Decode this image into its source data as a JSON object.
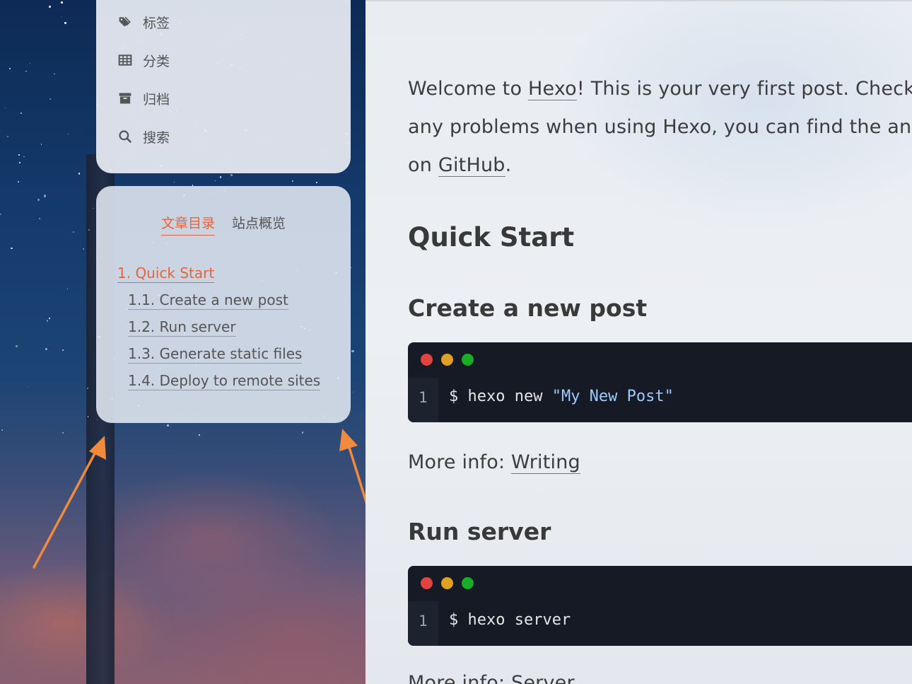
{
  "menu": {
    "items": [
      {
        "label": "标签",
        "icon": "tags-icon"
      },
      {
        "label": "分类",
        "icon": "grid-icon"
      },
      {
        "label": "归档",
        "icon": "archive-icon"
      },
      {
        "label": "搜索",
        "icon": "search-icon"
      }
    ]
  },
  "sidebar_tabs": {
    "toc": "文章目录",
    "overview": "站点概览"
  },
  "toc": {
    "items": [
      {
        "label": "1. Quick Start",
        "active": true
      },
      {
        "label": "1.1. Create a new post"
      },
      {
        "label": "1.2. Run server"
      },
      {
        "label": "1.3. Generate static files"
      },
      {
        "label": "1.4. Deploy to remote sites"
      }
    ]
  },
  "post": {
    "intro_line1_a": "Welcome to ",
    "intro_link_hexo": "Hexo",
    "intro_line1_b": "! This is your very first post. Check ",
    "intro_line2": "any problems when using Hexo, you can find the answ",
    "intro_line3_a": "on ",
    "intro_link_github": "GitHub",
    "intro_line3_b": ".",
    "h_quick_start": "Quick Start",
    "h_create": "Create a new post",
    "code1_lineno": "1",
    "code1_cmd": "$ hexo new ",
    "code1_str": "\"My New Post\"",
    "more_info1_label": "More info: ",
    "more_info1_link": "Writing",
    "h_run": "Run server",
    "code2_lineno": "1",
    "code2_cmd": "$ hexo server",
    "more_info2_partial": "More info: Server"
  },
  "colors": {
    "accent": "#e8643a",
    "arrow": "#f08a3c",
    "mac_red": "#e0443e",
    "mac_yellow": "#dea123",
    "mac_green": "#1aab29"
  }
}
